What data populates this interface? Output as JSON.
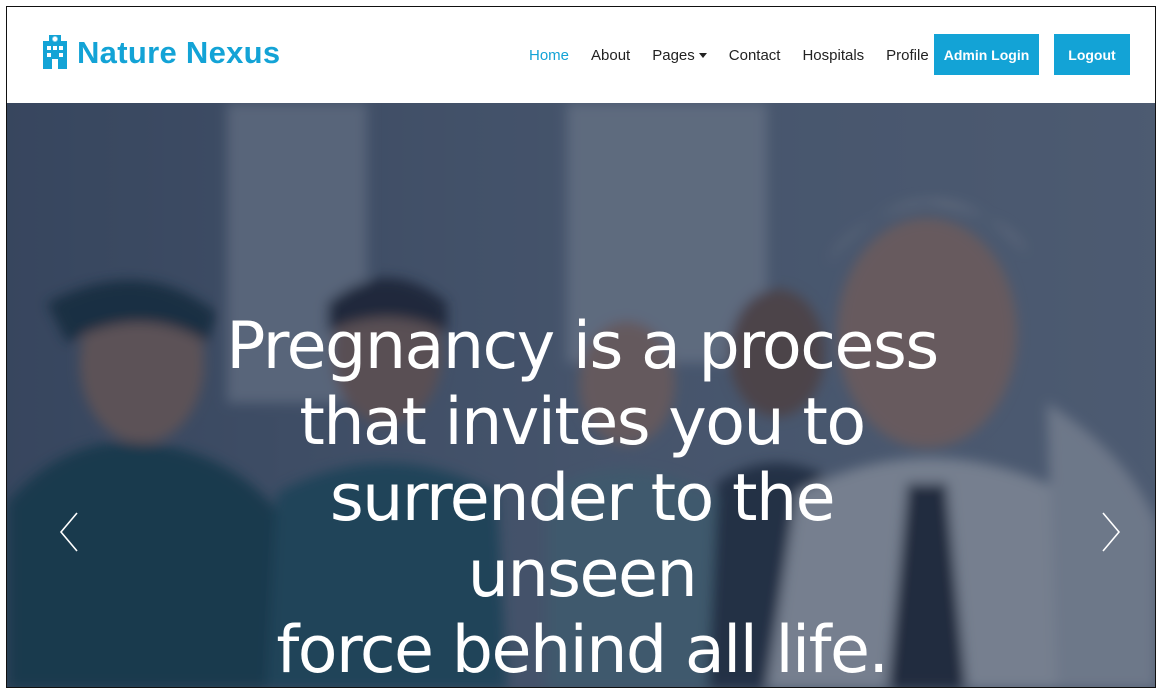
{
  "brand": {
    "name": "Nature Nexus",
    "icon": "hospital-building-icon"
  },
  "nav": {
    "links": [
      {
        "label": "Home",
        "active": true
      },
      {
        "label": "About",
        "active": false
      },
      {
        "label": "Pages",
        "active": false,
        "dropdown": true
      },
      {
        "label": "Contact",
        "active": false
      },
      {
        "label": "Hospitals",
        "active": false
      },
      {
        "label": "Profile",
        "active": false
      }
    ],
    "admin_login_label": "Admin Login",
    "logout_label": "Logout"
  },
  "hero": {
    "quote_lines": [
      "Pregnancy is a process",
      "that invites you to",
      "surrender to the unseen",
      "force behind all life."
    ],
    "prev_icon": "chevron-left-icon",
    "next_icon": "chevron-right-icon"
  },
  "colors": {
    "accent": "#13a3d6",
    "overlay": "#18243e",
    "text_dark": "#222222"
  }
}
